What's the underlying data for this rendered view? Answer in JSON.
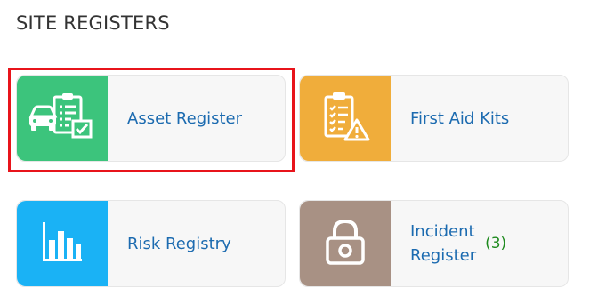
{
  "section": {
    "title": "SITE REGISTERS"
  },
  "cards": [
    {
      "label": "Asset Register",
      "icon": "asset-register-icon",
      "color": "#3cc47c"
    },
    {
      "label": "First Aid Kits",
      "icon": "first-aid-checklist-icon",
      "color": "#f0ad3b"
    },
    {
      "label": "Risk Registry",
      "icon": "bar-chart-icon",
      "color": "#1ab2f5"
    },
    {
      "label_line1": "Incident",
      "label_line2": "Register",
      "count": "(3)",
      "icon": "lock-icon",
      "color": "#a89184"
    }
  ],
  "colors": {
    "link": "#1c6bb0",
    "count": "#1e8a1e",
    "highlight": "#e8141b"
  }
}
